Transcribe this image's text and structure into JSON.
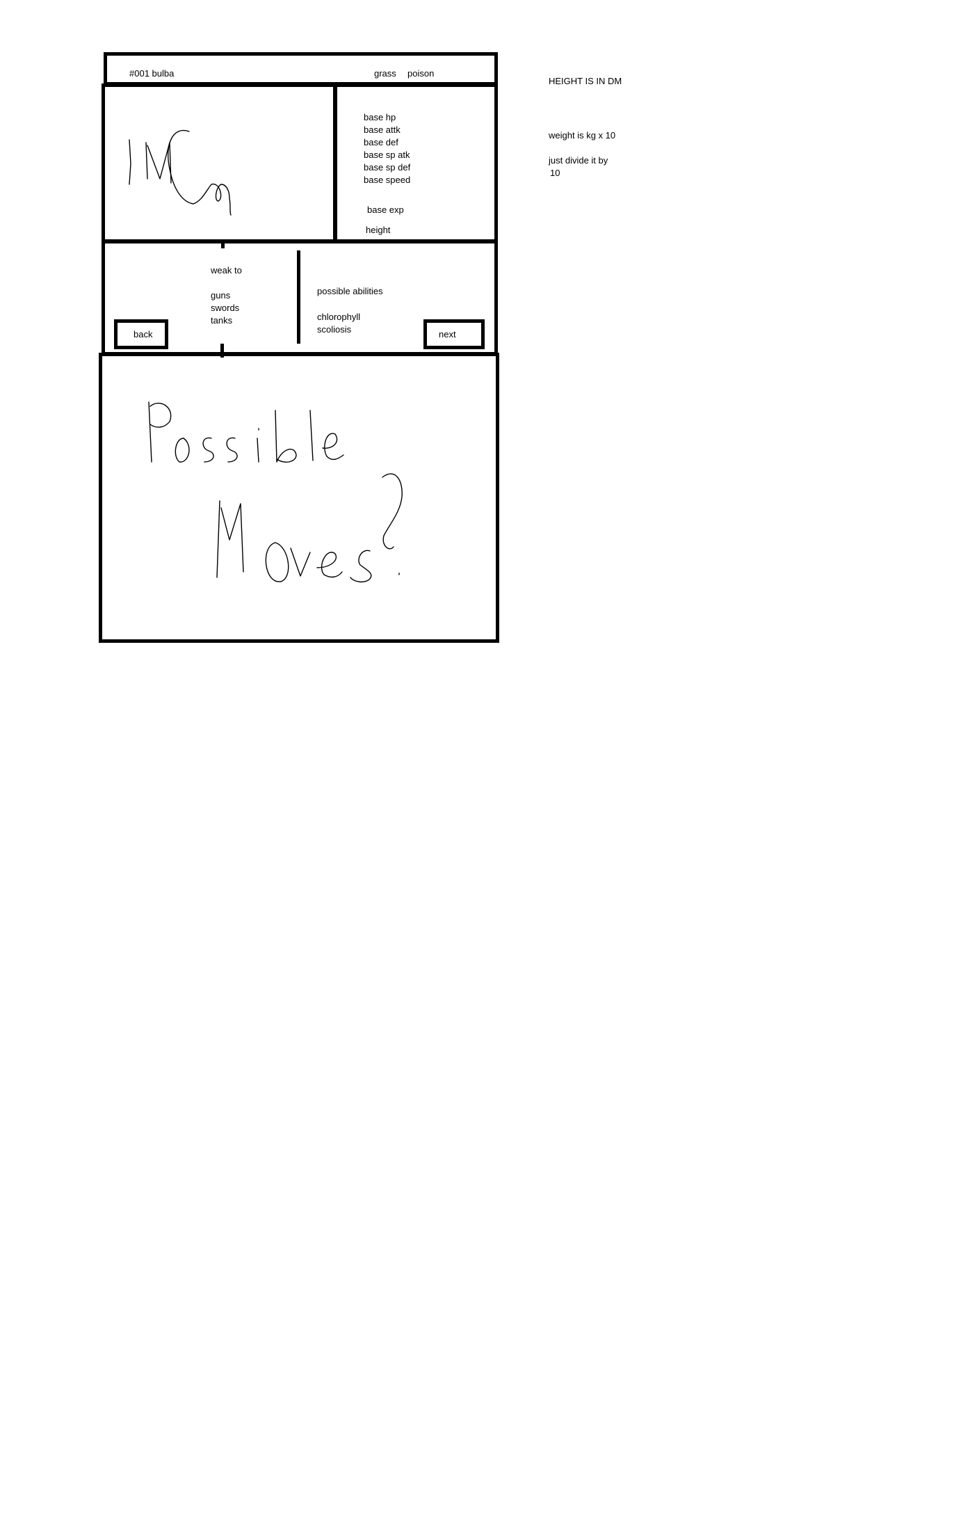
{
  "header": {
    "pokemon_id_name": "#001 bulba",
    "types": [
      "grass",
      "poison"
    ]
  },
  "image_panel": {
    "placeholder_label": "IMG"
  },
  "stats": {
    "items": [
      "base hp",
      "base attk",
      "base def",
      "base sp atk",
      "base sp def",
      "base speed"
    ],
    "base_exp": "base exp",
    "height": "height"
  },
  "weakness": {
    "heading": "weak to",
    "items": [
      "guns",
      "swords",
      "tanks"
    ]
  },
  "abilities": {
    "heading": "possible abilities",
    "items": [
      "chlorophyll",
      "scoliosis"
    ]
  },
  "nav": {
    "back_label": "back",
    "next_label": "next"
  },
  "moves_panel": {
    "placeholder_label": "Possible Moves?"
  },
  "notes": {
    "height_note": "HEIGHT IS IN DM",
    "weight_note": "weight is kg x 10",
    "divide_note_line1": "just divide it by",
    "divide_note_line2": "10"
  }
}
